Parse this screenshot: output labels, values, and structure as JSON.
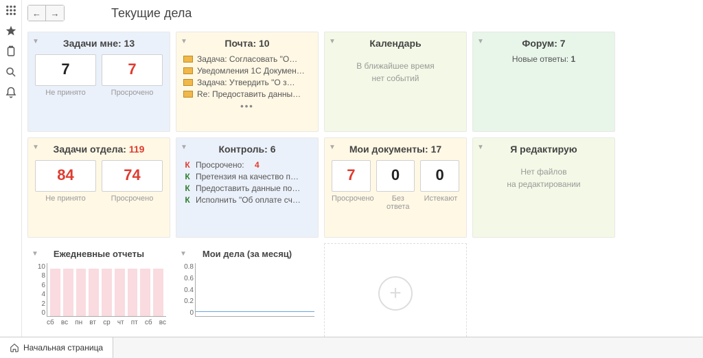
{
  "page_title": "Текущие дела",
  "bottom_tab": "Начальная страница",
  "widgets": {
    "tasks_me": {
      "title": "Задачи мне:",
      "count": "13",
      "not_accepted": "7",
      "overdue": "7",
      "lbl_na": "Не принято",
      "lbl_od": "Просрочено"
    },
    "mail": {
      "title": "Почта:",
      "count": "10",
      "items": [
        "Задача: Согласовать \"О…",
        "Уведомления 1С Докумен…",
        "Задача: Утвердить \"О з…",
        "Re: Предоставить данны…"
      ],
      "more": "•••"
    },
    "calendar": {
      "title": "Календарь",
      "empty1": "В ближайшее время",
      "empty2": "нет событий"
    },
    "forum": {
      "title": "Форум:",
      "count": "7",
      "line": "Новые ответы:",
      "num": "1"
    },
    "tasks_dept": {
      "title": "Задачи отдела:",
      "count": "119",
      "not_accepted": "84",
      "overdue": "74",
      "lbl_na": "Не принято",
      "lbl_od": "Просрочено"
    },
    "control": {
      "title": "Контроль:",
      "count": "6",
      "row0_k": "К",
      "row0_txt": "Просрочено:",
      "row0_num": "4",
      "row1_k": "К",
      "row1_txt": "Претензия на качество п…",
      "row2_k": "К",
      "row2_txt": "Предоставить данные по…",
      "row3_k": "К",
      "row3_txt": "Исполнить \"Об оплате сч…"
    },
    "mydocs": {
      "title": "Мои документы:",
      "count": "17",
      "v1": "7",
      "v2": "0",
      "v3": "0",
      "l1": "Просрочено",
      "l2": "Без ответа",
      "l3": "Истекают"
    },
    "editing": {
      "title": "Я редактирую",
      "empty1": "Нет файлов",
      "empty2": "на редактировании"
    },
    "daily": {
      "title": "Ежедневные отчеты"
    },
    "mybiz": {
      "title": "Мои дела (за месяц)"
    }
  },
  "chart_data": [
    {
      "type": "bar",
      "title": "Ежедневные отчеты",
      "categories": [
        "сб",
        "вс",
        "пн",
        "вт",
        "ср",
        "чт",
        "пт",
        "сб",
        "вс"
      ],
      "values": [
        9,
        9,
        9,
        9,
        9,
        9,
        9,
        9,
        9
      ],
      "ylim": [
        0,
        10
      ],
      "yticks": [
        0,
        2,
        4,
        6,
        8,
        10
      ]
    },
    {
      "type": "line",
      "title": "Мои дела (за месяц)",
      "x": [
        0,
        1,
        2,
        3,
        4,
        5,
        6,
        7,
        8,
        9,
        10,
        11,
        12,
        13,
        14,
        15,
        16,
        17,
        18,
        19,
        20,
        21,
        22,
        23,
        24,
        25,
        26,
        27,
        28,
        29
      ],
      "values": [
        0.05,
        0.05,
        0.05,
        0.05,
        0.05,
        0.05,
        0.05,
        0.05,
        0.05,
        0.05,
        0.05,
        0.05,
        0.05,
        0.05,
        0.05,
        0.05,
        0.05,
        0.05,
        0.05,
        0.05,
        0.05,
        0.05,
        0.05,
        0.05,
        0.05,
        0.05,
        0.05,
        0.05,
        0.05,
        0.05
      ],
      "ylim": [
        0,
        0.8
      ],
      "yticks": [
        0,
        0.2,
        0.4,
        0.6,
        0.8
      ]
    }
  ]
}
